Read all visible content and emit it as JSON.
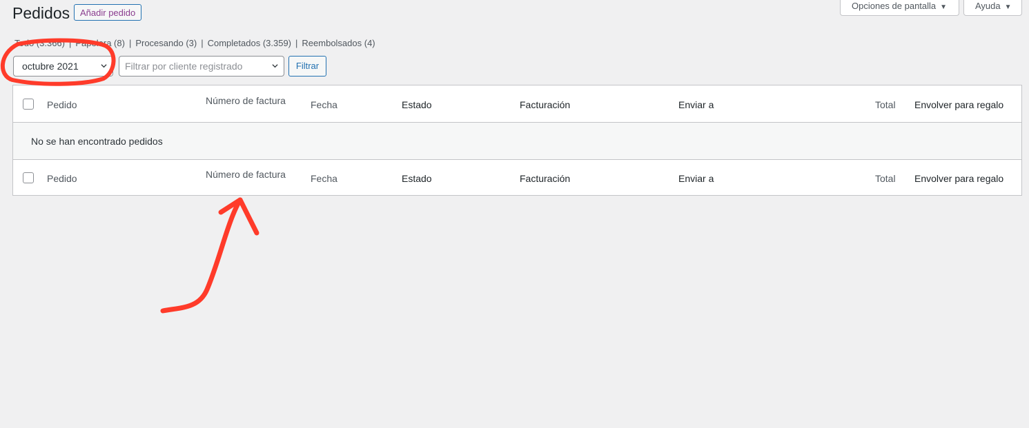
{
  "header": {
    "title": "Pedidos",
    "add_label": "Añadir pedido",
    "screen_options": "Opciones de pantalla",
    "help": "Ayuda"
  },
  "status_links": [
    {
      "label": "Todo (3.366)"
    },
    {
      "label": "Papelera (8)"
    },
    {
      "label": "Procesando (3)"
    },
    {
      "label": "Completados (3.359)"
    },
    {
      "label": "Reembolsados (4)"
    }
  ],
  "filters": {
    "month_value": "octubre 2021",
    "customer_placeholder": "Filtrar por cliente registrado",
    "filter_label": "Filtrar"
  },
  "table": {
    "columns": [
      "Pedido",
      "Número de factura",
      "Fecha",
      "Estado",
      "Facturación",
      "Enviar a",
      "Total",
      "Envolver para regalo"
    ],
    "empty_message": "No se han encontrado pedidos"
  },
  "colors": {
    "accent": "#2271b1",
    "annotation": "#ff3b2a",
    "add_button_text": "#8a3d8f"
  }
}
